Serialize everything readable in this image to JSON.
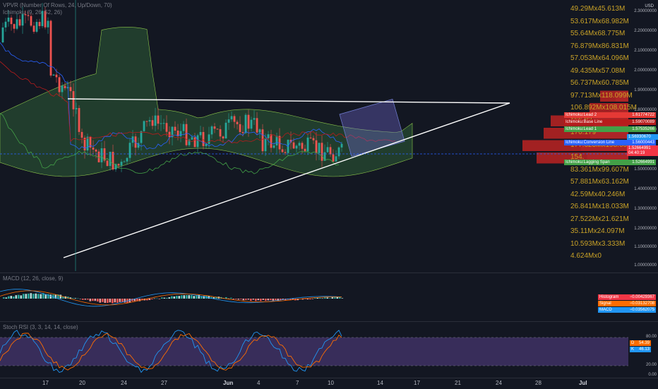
{
  "main": {
    "legend": [
      "VPVR (Number Of Rows, 24, Up/Down, 70)",
      "Ichimoku (9, 26, 52, 26)"
    ],
    "currency": "USD",
    "price_ticks": [
      "2.30000000",
      "2.20000000",
      "2.10000000",
      "2.00000000",
      "1.90000000",
      "1.80000000",
      "1.70000000",
      "1.60000000",
      "1.50000000",
      "1.40000000",
      "1.30000000",
      "1.20000000",
      "1.10000000",
      "1.00000000",
      "0.20000000"
    ],
    "vp_labels": [
      "49.29Mx45.613M",
      "53.617Mx68.982M",
      "55.64Mx68.775M",
      "76.879Mx86.831M",
      "57.053Mx64.096M",
      "49.435Mx57.08M",
      "56.737Mx60.785M",
      "97.713Mx118.099M",
      "106.892Mx108.015M",
      "166.82",
      "170.179",
      "177.623Mx198.602M",
      "154.",
      "83.361Mx99.607M",
      "57.881Mx63.162M",
      "42.59Mx40.246M",
      "26.841Mx18.033M",
      "27.522Mx21.621M",
      "35.11Mx24.097M",
      "10.593Mx3.333M",
      "4.624Mx0"
    ],
    "tags": [
      {
        "label": "Ichimoku:Lead 2",
        "value": "1.61774722",
        "color": "#e53935"
      },
      {
        "label": "Ichimoku:Base Line",
        "value": "1.59070089",
        "color": "#b71c1c"
      },
      {
        "label": "Ichimoku:Lead 1",
        "value": "1.57535266",
        "color": "#43a047"
      },
      {
        "label": "",
        "value": "1.56930670",
        "color": "#2196f3"
      },
      {
        "label": "Ichimoku:Conversion Line",
        "value": "1.56000443",
        "color": "#2962ff"
      },
      {
        "label": "",
        "value": "1.52664991",
        "color": "#f23645"
      },
      {
        "label": "",
        "value": "04:40:19",
        "color": "#f23645"
      },
      {
        "label": "Ichimoku:Lagging Span",
        "value": "1.52664991",
        "color": "#43a047"
      }
    ]
  },
  "macd": {
    "legend": "MACD (12, 26, close, 9)",
    "tags": [
      {
        "label": "Histogram",
        "value": "−0.00429367",
        "color": "#f23645"
      },
      {
        "label": "Signal",
        "value": "−0.03132708",
        "color": "#ff6d00"
      },
      {
        "label": "MACD",
        "value": "−0.03562075",
        "color": "#2196f3"
      }
    ]
  },
  "stoch": {
    "legend": "Stoch RSI (3, 3, 14, 14, close)",
    "ticks": [
      "80.00",
      "20.00",
      "0.00"
    ],
    "tags": [
      {
        "label": "D",
        "value": "54.39",
        "color": "#ff6d00"
      },
      {
        "label": "K",
        "value": "46.13",
        "color": "#2196f3"
      }
    ]
  },
  "time_axis": [
    {
      "label": "17",
      "bold": false
    },
    {
      "label": "20",
      "bold": false
    },
    {
      "label": "24",
      "bold": false
    },
    {
      "label": "27",
      "bold": false
    },
    {
      "label": "Jun",
      "bold": true
    },
    {
      "label": "4",
      "bold": false
    },
    {
      "label": "7",
      "bold": false
    },
    {
      "label": "10",
      "bold": false
    },
    {
      "label": "14",
      "bold": false
    },
    {
      "label": "17",
      "bold": false
    },
    {
      "label": "21",
      "bold": false
    },
    {
      "label": "24",
      "bold": false
    },
    {
      "label": "28",
      "bold": false
    },
    {
      "label": "Jul",
      "bold": true
    }
  ],
  "colors": {
    "up": "#26a69a",
    "down": "#ef5350",
    "bg": "#131722"
  }
}
